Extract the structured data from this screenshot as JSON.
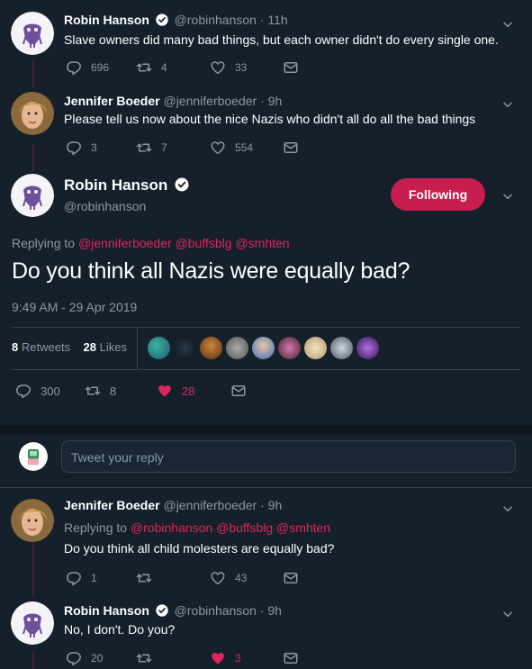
{
  "colors": {
    "background": "#15202b",
    "accent": "#e0245e",
    "muted": "#8899a6",
    "follow": "#c71e4f"
  },
  "tweet1": {
    "name": "Robin Hanson",
    "handle": "@robinhanson",
    "time": "· 11h",
    "text": "Slave owners did many bad things, but each owner didn't do every single one.",
    "replies": "696",
    "retweets": "4",
    "likes": "33"
  },
  "tweet2": {
    "name": "Jennifer Boeder",
    "handle": "@jenniferboeder",
    "time": "· 9h",
    "text": "Please tell us now about the nice Nazis who didn't all do all the bad things",
    "replies": "3",
    "retweets": "7",
    "likes": "554"
  },
  "main": {
    "name": "Robin Hanson",
    "handle": "@robinhanson",
    "follow_label": "Following",
    "replying_prefix": "Replying to",
    "mentions": [
      "@jenniferboeder",
      "@buffsblg",
      "@smhten"
    ],
    "text": "Do you think all Nazis were equally bad?",
    "timestamp": "9:49 AM - 29 Apr 2019",
    "retweets_count": "8",
    "retweets_label": "Retweets",
    "likes_count": "28",
    "likes_label": "Likes",
    "replies": "300",
    "retweets": "8",
    "likes": "28"
  },
  "compose": {
    "placeholder": "Tweet your reply"
  },
  "reply1": {
    "name": "Jennifer Boeder",
    "handle": "@jenniferboeder",
    "time": "· 9h",
    "replying_prefix": "Replying to",
    "mentions": [
      "@robinhanson",
      "@buffsblg",
      "@smhten"
    ],
    "text": "Do you think all child molesters are equally bad?",
    "replies": "1",
    "retweets": "",
    "likes": "43"
  },
  "reply2": {
    "name": "Robin Hanson",
    "handle": "@robinhanson",
    "time": "· 9h",
    "text": "No, I don't. Do you?",
    "replies": "20",
    "retweets": "",
    "likes": "3"
  },
  "icons": [
    "reply-icon",
    "retweet-icon",
    "heart-icon",
    "mail-icon",
    "verified-icon",
    "chevron-down-icon"
  ]
}
